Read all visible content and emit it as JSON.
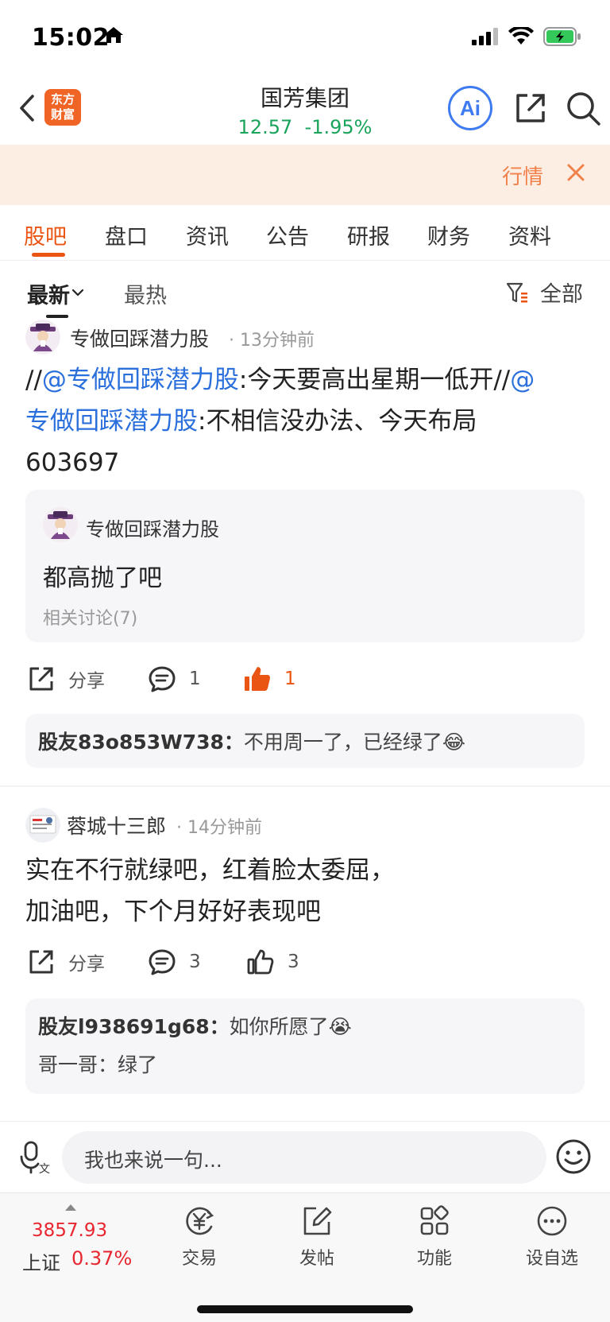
{
  "status": {
    "time": "15:02"
  },
  "header": {
    "logo_text_line1": "东方",
    "logo_text_line2": "财富",
    "stock_name": "国芳集团",
    "price": "12.57",
    "change": "-1.95%",
    "ai_label": "Ai"
  },
  "banner": {
    "label": "行情"
  },
  "tabs": [
    {
      "label": "股吧"
    },
    {
      "label": "盘口"
    },
    {
      "label": "资讯"
    },
    {
      "label": "公告"
    },
    {
      "label": "研报"
    },
    {
      "label": "财务"
    },
    {
      "label": "资料"
    }
  ],
  "filter": {
    "latest": "最新",
    "hot": "最热",
    "all": "全部"
  },
  "posts": [
    {
      "author": "专做回踩潜力股",
      "time": "· 13分钟前",
      "body_prefix": "//",
      "mention1": "@专做回踩潜力股",
      "body_mid": ":今天要高出星期一低开//",
      "mention2_line1": "@",
      "mention2_line2": "专做回踩潜力股",
      "body_end": ":不相信没办法、今天布局",
      "body_code": "603697",
      "quote": {
        "author": "专做回踩潜力股",
        "text": "都高抛了吧",
        "related": "相关讨论(7)"
      },
      "share_label": "分享",
      "comment_count": "1",
      "like_count": "1",
      "comment": {
        "user": "股友83o853W738：",
        "text": "不用周一了，已经绿了😂"
      }
    },
    {
      "author": "蓉城十三郎",
      "time": "· 14分钟前",
      "body_line1": "实在不行就绿吧，红着脸太委屈，",
      "body_line2": "加油吧，下个月好好表现吧",
      "share_label": "分享",
      "comment_count": "3",
      "like_count": "3",
      "comment": {
        "user": "股友l938691g68：",
        "text": "如你所愿了😭",
        "cut_line": "哥一哥：绿了"
      }
    }
  ],
  "input": {
    "placeholder": "我也来说一句..."
  },
  "bottom_nav": {
    "index_value": "3857.93",
    "index_name": "上证",
    "index_change": "0.37%",
    "items": [
      {
        "label": "交易",
        "icon": "yen-icon"
      },
      {
        "label": "发帖",
        "icon": "edit-icon"
      },
      {
        "label": "功能",
        "icon": "grid-icon"
      },
      {
        "label": "设自选",
        "icon": "more-icon"
      }
    ]
  },
  "colors": {
    "accent": "#ea5513",
    "green": "#19a35b",
    "red": "#e8262f",
    "mention_blue": "#2a6fdb",
    "ai_blue": "#3e7bf0"
  }
}
